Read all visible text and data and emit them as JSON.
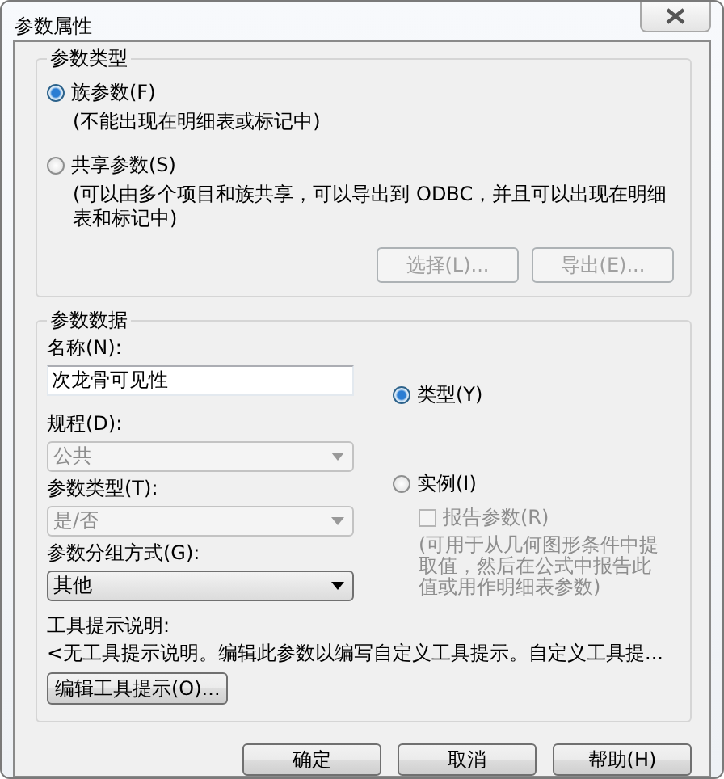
{
  "window": {
    "title": "参数属性"
  },
  "parameter_type": {
    "title": "参数类型",
    "options": [
      {
        "label": "族参数(F)",
        "note": "(不能出现在明细表或标记中)",
        "selected": true
      },
      {
        "label": "共享参数(S)",
        "note": "(可以由多个项目和族共享，可以导出到 ODBC，并且可以出现在明细表和标记中)",
        "selected": false
      }
    ],
    "buttons": [
      {
        "label": "选择(L)...",
        "disabled": true
      },
      {
        "label": "导出(E)...",
        "disabled": true
      }
    ]
  },
  "parameter_data": {
    "title": "参数数据",
    "name": {
      "label": "名称(N):",
      "value": "次龙骨可见性"
    },
    "fields": [
      {
        "label": "规程(D):",
        "value": "公共",
        "disabled": true
      },
      {
        "label": "参数类型(T):",
        "value": "是/否",
        "disabled": true
      },
      {
        "label": "参数分组方式(G):",
        "value": "其他",
        "disabled": false
      }
    ],
    "scope": [
      {
        "label": "类型(Y)",
        "selected": true
      },
      {
        "label": "实例(I)",
        "selected": false
      }
    ],
    "reporting": {
      "label": "报告参数(R)",
      "checked": false,
      "disabled": true,
      "note": "(可用于从几何图形条件中提取值，然后在公式中报告此值或用作明细表参数)"
    },
    "tooltip": {
      "label": "工具提示说明:",
      "text": "<无工具提示说明。编辑此参数以编写自定义工具提示。自定义工具提...",
      "button": "编辑工具提示(O)..."
    }
  },
  "buttons": [
    {
      "label": "确定"
    },
    {
      "label": "取消"
    },
    {
      "label": "帮助(H)"
    }
  ]
}
